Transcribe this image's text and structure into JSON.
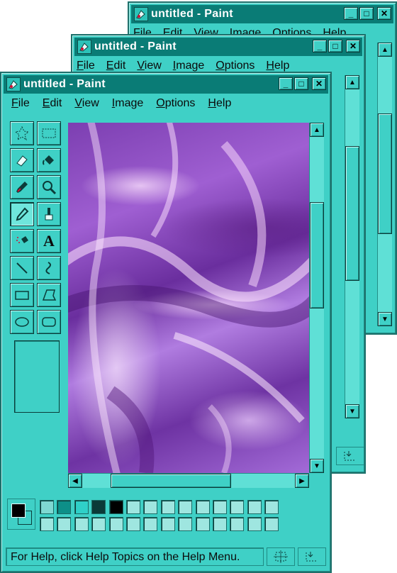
{
  "app": {
    "title": "untitled - Paint",
    "menu": [
      "File",
      "Edit",
      "View",
      "Image",
      "Options",
      "Help"
    ],
    "window_buttons": {
      "minimize": "_",
      "maximize": "□",
      "close": "✕"
    }
  },
  "tools": [
    {
      "name": "free-form-select",
      "icon": "star-select-icon"
    },
    {
      "name": "select",
      "icon": "rect-select-icon"
    },
    {
      "name": "eraser",
      "icon": "eraser-icon"
    },
    {
      "name": "fill-with-color",
      "icon": "paint-bucket-icon"
    },
    {
      "name": "pick-color",
      "icon": "eyedropper-icon"
    },
    {
      "name": "magnifier",
      "icon": "magnifier-icon"
    },
    {
      "name": "pencil",
      "icon": "pencil-icon",
      "active": true
    },
    {
      "name": "brush",
      "icon": "brush-icon"
    },
    {
      "name": "airbrush",
      "icon": "airbrush-icon"
    },
    {
      "name": "text",
      "icon": "text-icon",
      "glyph": "A"
    },
    {
      "name": "line",
      "icon": "line-icon"
    },
    {
      "name": "curve",
      "icon": "curve-icon"
    },
    {
      "name": "rectangle",
      "icon": "rectangle-icon"
    },
    {
      "name": "polygon",
      "icon": "polygon-icon"
    },
    {
      "name": "ellipse",
      "icon": "ellipse-icon"
    },
    {
      "name": "rounded-rectangle",
      "icon": "rounded-rect-icon"
    }
  ],
  "palette": {
    "foreground": "#000000",
    "background": "#3fd0c6",
    "top_row": [
      "#7fd8d2",
      "#0d8f88",
      "#2fd0c8",
      "#0b3a38",
      "#000000",
      "#9fe6e0",
      "#9fe6e0",
      "#9fe6e0",
      "#9fe6e0",
      "#9fe6e0",
      "#9fe6e0",
      "#9fe6e0",
      "#9fe6e0",
      "#9fe6e0"
    ],
    "bottom_row": [
      "#9fe6e0",
      "#9fe6e0",
      "#9fe6e0",
      "#9fe6e0",
      "#9fe6e0",
      "#9fe6e0",
      "#9fe6e0",
      "#9fe6e0",
      "#9fe6e0",
      "#9fe6e0",
      "#9fe6e0",
      "#9fe6e0",
      "#9fe6e0",
      "#9fe6e0"
    ]
  },
  "status": {
    "help_text": "For Help, click Help Topics on the Help Menu."
  },
  "colors": {
    "window": "#3fd0c6",
    "titlebar": "#0a7c76",
    "canvas_image": "purple satin"
  }
}
